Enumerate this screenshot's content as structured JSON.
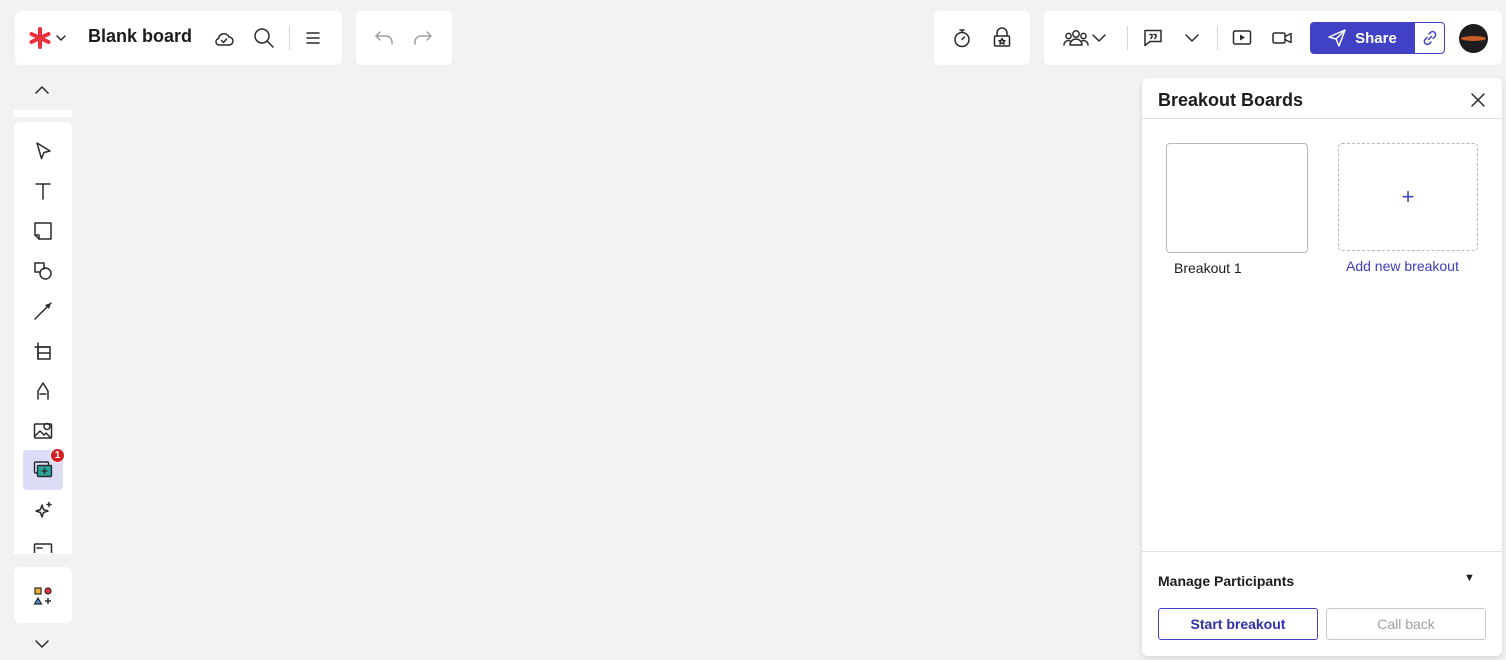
{
  "header": {
    "board_title": "Blank board",
    "share_label": "Share"
  },
  "toolbar": {
    "active_tool_badge": "1"
  },
  "breakout": {
    "title": "Breakout Boards",
    "boards": [
      {
        "label": "Breakout 1"
      }
    ],
    "add_label": "Add new breakout",
    "add_symbol": "+",
    "manage_participants": "Manage Participants",
    "manage_caret": "▼",
    "start_label": "Start breakout",
    "callback_label": "Call back"
  },
  "colors": {
    "accent": "#4041c4",
    "logo": "#e8323c",
    "badge": "#d21f1f",
    "canvas": "#f1f2f4"
  },
  "icons": [
    "logo-icon",
    "cloud-icon",
    "search-icon",
    "menu-icon",
    "undo-icon",
    "redo-icon",
    "timer-icon",
    "gift-icon",
    "collaborators-icon",
    "chat-icon",
    "present-icon",
    "video-icon",
    "send-icon",
    "link-icon",
    "close-icon",
    "select-icon",
    "text-icon",
    "sticky-note-icon",
    "shapes-icon",
    "line-icon",
    "frame-icon",
    "pen-icon",
    "image-icon",
    "breakout-icon",
    "ai-sparkle-icon",
    "template-icon",
    "apps-icon",
    "chevron-up-icon",
    "chevron-down-icon"
  ]
}
